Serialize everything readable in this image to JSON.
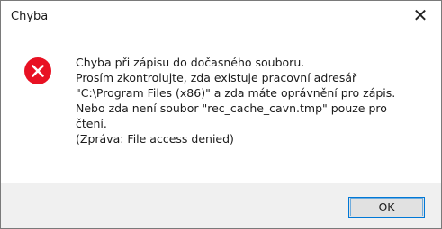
{
  "window": {
    "title": "Chyba",
    "close_glyph": "✕"
  },
  "message": {
    "icon": "error-icon",
    "lines": [
      "Chyba při zápisu do dočasného souboru.",
      "Prosím zkontrolujte, zda existuje pracovní adresář",
      "\"C:\\Program Files (x86)\" a zda máte oprávnění pro zápis.",
      "Nebo zda není soubor \"rec_cache_cavn.tmp\" pouze pro",
      "čtení.",
      "(Zpráva: File access denied)"
    ]
  },
  "buttons": {
    "ok_label": "OK"
  },
  "colors": {
    "error_red": "#e81123",
    "accent": "#0078d7",
    "footer_bg": "#f0f0f0"
  }
}
